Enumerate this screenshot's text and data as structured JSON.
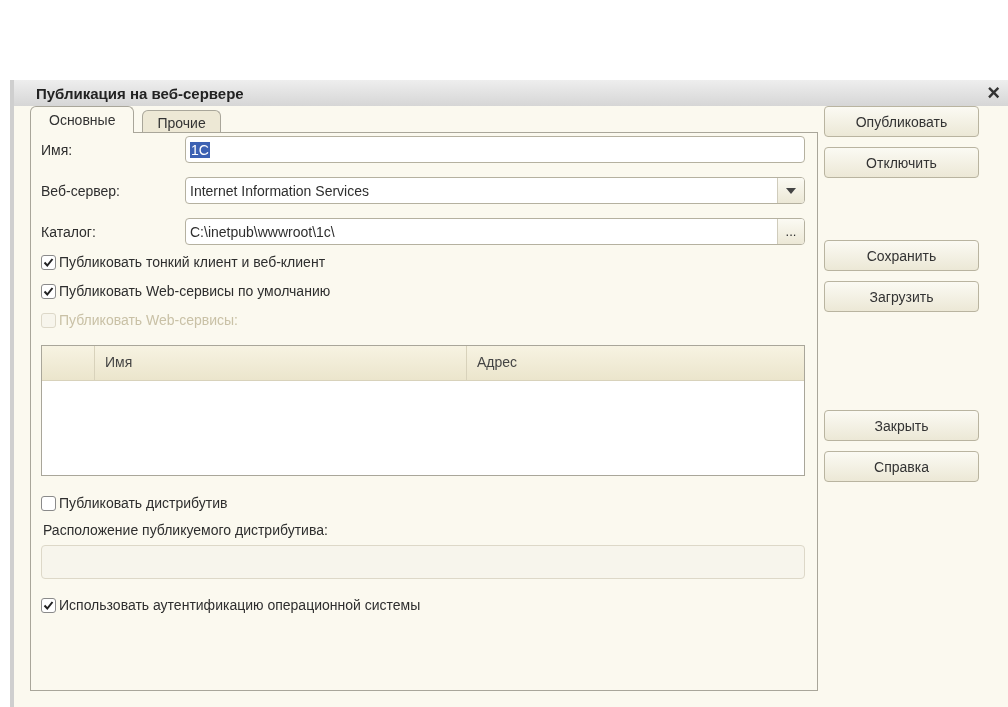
{
  "window": {
    "title": "Публикация на веб-сервере",
    "close": "×"
  },
  "tabs": [
    {
      "label": "Основные",
      "selected": true
    },
    {
      "label": "Прочие",
      "selected": false
    }
  ],
  "fields": {
    "name": {
      "label": "Имя:",
      "value": "1C",
      "text_selected": true
    },
    "web_server": {
      "label": "Веб-сервер:",
      "value": "Internet Information Services"
    },
    "catalog": {
      "label": "Каталог:",
      "value": "C:\\inetpub\\wwwroot\\1c\\",
      "choose_button": "..."
    }
  },
  "options": [
    {
      "label": "Публиковать тонкий клиент и веб-клиент",
      "checked": true,
      "disabled": false
    },
    {
      "label": "Публиковать Web-сервисы по умолчанию",
      "checked": true,
      "disabled": false
    },
    {
      "label": "Публиковать Web-сервисы:",
      "checked": false,
      "disabled": true
    }
  ],
  "table": {
    "columns": [
      "Имя",
      "Адрес"
    ]
  },
  "distribution": {
    "checkbox": {
      "label": "Публиковать дистрибутив",
      "checked": false,
      "disabled": false
    },
    "location_label": "Расположение публикуемого дистрибутива:",
    "location_field": {
      "disabled": true
    }
  },
  "os_auth": {
    "label": "Использовать аутентификацию операционной системы",
    "checked": true,
    "disabled": false
  },
  "button_groups": [
    [
      "Опубликовать",
      "Отключить"
    ],
    [
      "Сохранить",
      "Загрузить"
    ],
    [
      "Закрыть",
      "Справка"
    ]
  ]
}
